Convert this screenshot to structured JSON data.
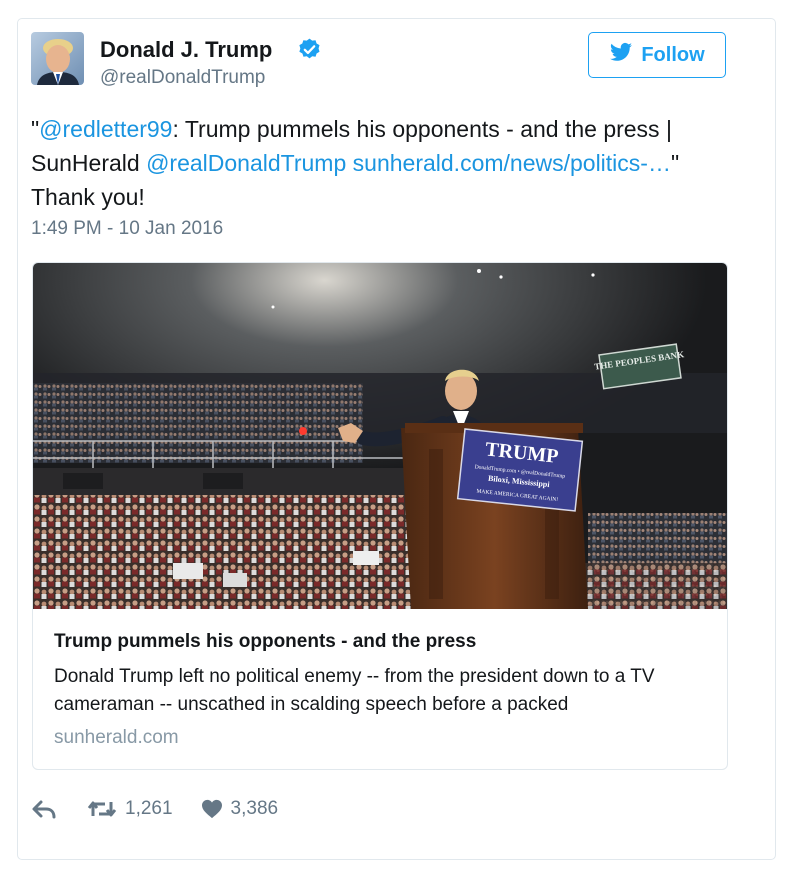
{
  "author": {
    "name": "Donald J. Trump",
    "handle": "@realDonaldTrump",
    "avatar_icon": "profile-photo",
    "verified_icon": "verified-badge-icon"
  },
  "follow": {
    "label": "Follow",
    "icon": "twitter-bird-icon"
  },
  "tweet": {
    "open_quote": "\"",
    "mention1": "@redletter99",
    "text1": ": Trump pummels his opponents - and the press | SunHerald ",
    "mention2": "@realDonaldTrump",
    "space": " ",
    "link": "sunherald.com/news/politics-…",
    "close_quote": "\"",
    "thanks": "Thank you!",
    "timestamp": "1:49 PM - 10 Jan 2016"
  },
  "card": {
    "image": "rally-photo",
    "podium_sign": {
      "title": "TRUMP",
      "line1": "DonaldTrump.com • @realDonaldTrump",
      "line2": "Biloxi, Mississippi",
      "line3": "MAKE AMERICA GREAT AGAIN!"
    },
    "arena_sign": "THE PEOPLES BANK",
    "title": "Trump pummels his opponents - and the press",
    "description": "Donald Trump left no political enemy -- from the president down to a TV cameraman -- unscathed in scalding speech before a packed",
    "domain": "sunherald.com"
  },
  "actions": {
    "reply_icon": "reply-icon",
    "retweet_icon": "retweet-icon",
    "retweet_count": "1,261",
    "like_icon": "heart-icon",
    "like_count": "3,386"
  },
  "colors": {
    "link": "#1b95e0",
    "accent": "#1da1f2",
    "muted": "#657786"
  }
}
